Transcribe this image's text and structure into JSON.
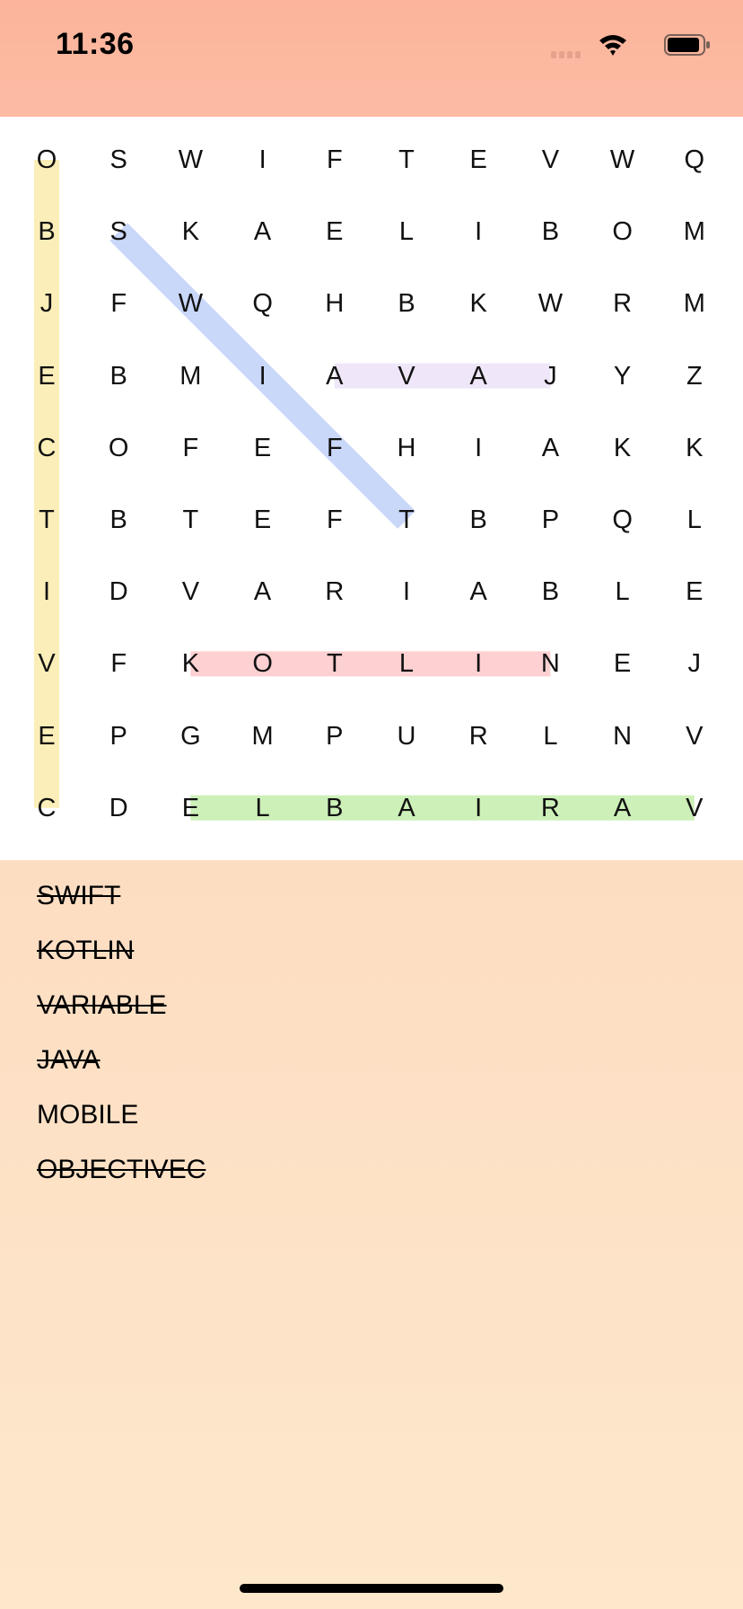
{
  "status_bar": {
    "time": "11:36",
    "icons": [
      "signal-icon",
      "wifi-icon",
      "battery-icon"
    ]
  },
  "grid": {
    "rows": [
      [
        "O",
        "S",
        "W",
        "I",
        "F",
        "T",
        "E",
        "V",
        "W",
        "Q"
      ],
      [
        "B",
        "S",
        "K",
        "A",
        "E",
        "L",
        "I",
        "B",
        "O",
        "M"
      ],
      [
        "J",
        "F",
        "W",
        "Q",
        "H",
        "B",
        "K",
        "W",
        "R",
        "M"
      ],
      [
        "E",
        "B",
        "M",
        "I",
        "A",
        "V",
        "A",
        "J",
        "Y",
        "Z"
      ],
      [
        "C",
        "O",
        "F",
        "E",
        "F",
        "H",
        "I",
        "A",
        "K",
        "K"
      ],
      [
        "T",
        "B",
        "T",
        "E",
        "F",
        "T",
        "B",
        "P",
        "Q",
        "L"
      ],
      [
        "I",
        "D",
        "V",
        "A",
        "R",
        "I",
        "A",
        "B",
        "L",
        "E"
      ],
      [
        "V",
        "F",
        "K",
        "O",
        "T",
        "L",
        "I",
        "N",
        "E",
        "J"
      ],
      [
        "E",
        "P",
        "G",
        "M",
        "P",
        "U",
        "R",
        "L",
        "N",
        "V"
      ],
      [
        "C",
        "D",
        "E",
        "L",
        "B",
        "A",
        "I",
        "R",
        "A",
        "V"
      ]
    ]
  },
  "found_words": [
    {
      "word": "OBJECTIVEC",
      "color": "#fbeeb8",
      "start": [
        0,
        0
      ],
      "end": [
        9,
        0
      ]
    },
    {
      "word": "SWIFT",
      "color": "#c9d7f9",
      "start": [
        1,
        1
      ],
      "end": [
        5,
        5
      ]
    },
    {
      "word": "JAVA",
      "color": "#efe6f9",
      "start": [
        3,
        7
      ],
      "end": [
        3,
        4
      ]
    },
    {
      "word": "KOTLIN",
      "color": "#fdd0d2",
      "start": [
        7,
        2
      ],
      "end": [
        7,
        7
      ]
    },
    {
      "word": "VARIABLE",
      "color": "#cdf0b8",
      "start": [
        9,
        9
      ],
      "end": [
        9,
        2
      ]
    }
  ],
  "word_list": [
    {
      "label": "SWIFT",
      "found": true
    },
    {
      "label": "KOTLIN",
      "found": true
    },
    {
      "label": "VARIABLE",
      "found": true
    },
    {
      "label": "JAVA",
      "found": true
    },
    {
      "label": "MOBILE",
      "found": false
    },
    {
      "label": "OBJECTIVEC",
      "found": true
    }
  ]
}
